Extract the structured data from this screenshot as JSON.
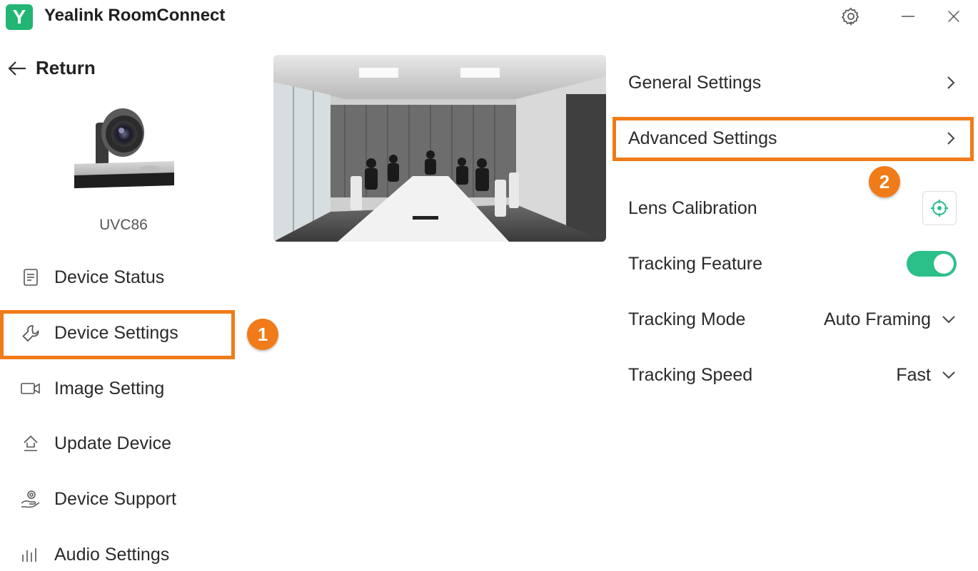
{
  "app": {
    "logo_letter": "Y",
    "title": "Yealink RoomConnect"
  },
  "nav": {
    "return_label": "Return",
    "device_name": "UVC86",
    "items": [
      {
        "label": "Device Status",
        "icon": "document-icon"
      },
      {
        "label": "Device Settings",
        "icon": "wrench-icon"
      },
      {
        "label": "Image Setting",
        "icon": "video-camera-icon"
      },
      {
        "label": "Update Device",
        "icon": "upload-icon"
      },
      {
        "label": "Device Support",
        "icon": "support-hand-icon"
      },
      {
        "label": "Audio Settings",
        "icon": "audio-bars-icon"
      }
    ]
  },
  "settings": {
    "general": "General Settings",
    "advanced": "Advanced Settings",
    "lens_calibration": "Lens Calibration",
    "tracking_feature": "Tracking Feature",
    "tracking_feature_on": true,
    "tracking_mode_label": "Tracking Mode",
    "tracking_mode_value": "Auto Framing",
    "tracking_speed_label": "Tracking Speed",
    "tracking_speed_value": "Fast"
  },
  "annotations": {
    "step1": "1",
    "step2": "2"
  },
  "colors": {
    "accent": "#2bbf8a",
    "brand": "#22b573",
    "highlight": "#f07b18"
  }
}
